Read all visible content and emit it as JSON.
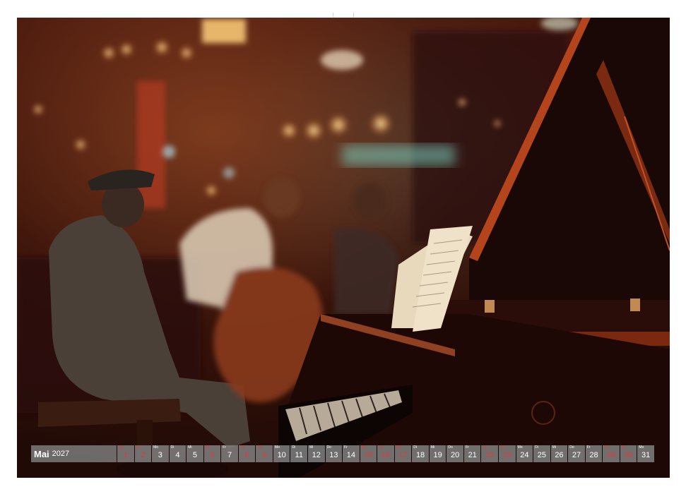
{
  "calendar": {
    "month": "Mai",
    "year": "2027",
    "days": [
      {
        "wd": "Sa",
        "num": "1",
        "red": true
      },
      {
        "wd": "So",
        "num": "2",
        "red": true
      },
      {
        "wd": "Mo",
        "num": "3",
        "red": false
      },
      {
        "wd": "Di",
        "num": "4",
        "red": false
      },
      {
        "wd": "Mi",
        "num": "5",
        "red": false
      },
      {
        "wd": "Do",
        "num": "6",
        "red": true
      },
      {
        "wd": "Fr",
        "num": "7",
        "red": false
      },
      {
        "wd": "Sa",
        "num": "8",
        "red": true
      },
      {
        "wd": "So",
        "num": "9",
        "red": true
      },
      {
        "wd": "Mo",
        "num": "10",
        "red": false
      },
      {
        "wd": "Di",
        "num": "11",
        "red": false
      },
      {
        "wd": "Mi",
        "num": "12",
        "red": false
      },
      {
        "wd": "Do",
        "num": "13",
        "red": false
      },
      {
        "wd": "Fr",
        "num": "14",
        "red": false
      },
      {
        "wd": "Sa",
        "num": "15",
        "red": true
      },
      {
        "wd": "So",
        "num": "16",
        "red": true
      },
      {
        "wd": "Mo",
        "num": "17",
        "red": true
      },
      {
        "wd": "Di",
        "num": "18",
        "red": false
      },
      {
        "wd": "Mi",
        "num": "19",
        "red": false
      },
      {
        "wd": "Do",
        "num": "20",
        "red": false
      },
      {
        "wd": "Fr",
        "num": "21",
        "red": false
      },
      {
        "wd": "Sa",
        "num": "22",
        "red": true
      },
      {
        "wd": "So",
        "num": "23",
        "red": true
      },
      {
        "wd": "Mo",
        "num": "24",
        "red": false
      },
      {
        "wd": "Di",
        "num": "25",
        "red": false
      },
      {
        "wd": "Mi",
        "num": "26",
        "red": false
      },
      {
        "wd": "Do",
        "num": "27",
        "red": false
      },
      {
        "wd": "Fr",
        "num": "28",
        "red": false
      },
      {
        "wd": "Sa",
        "num": "29",
        "red": true
      },
      {
        "wd": "So",
        "num": "30",
        "red": true
      },
      {
        "wd": "Mo",
        "num": "31",
        "red": false
      }
    ]
  }
}
